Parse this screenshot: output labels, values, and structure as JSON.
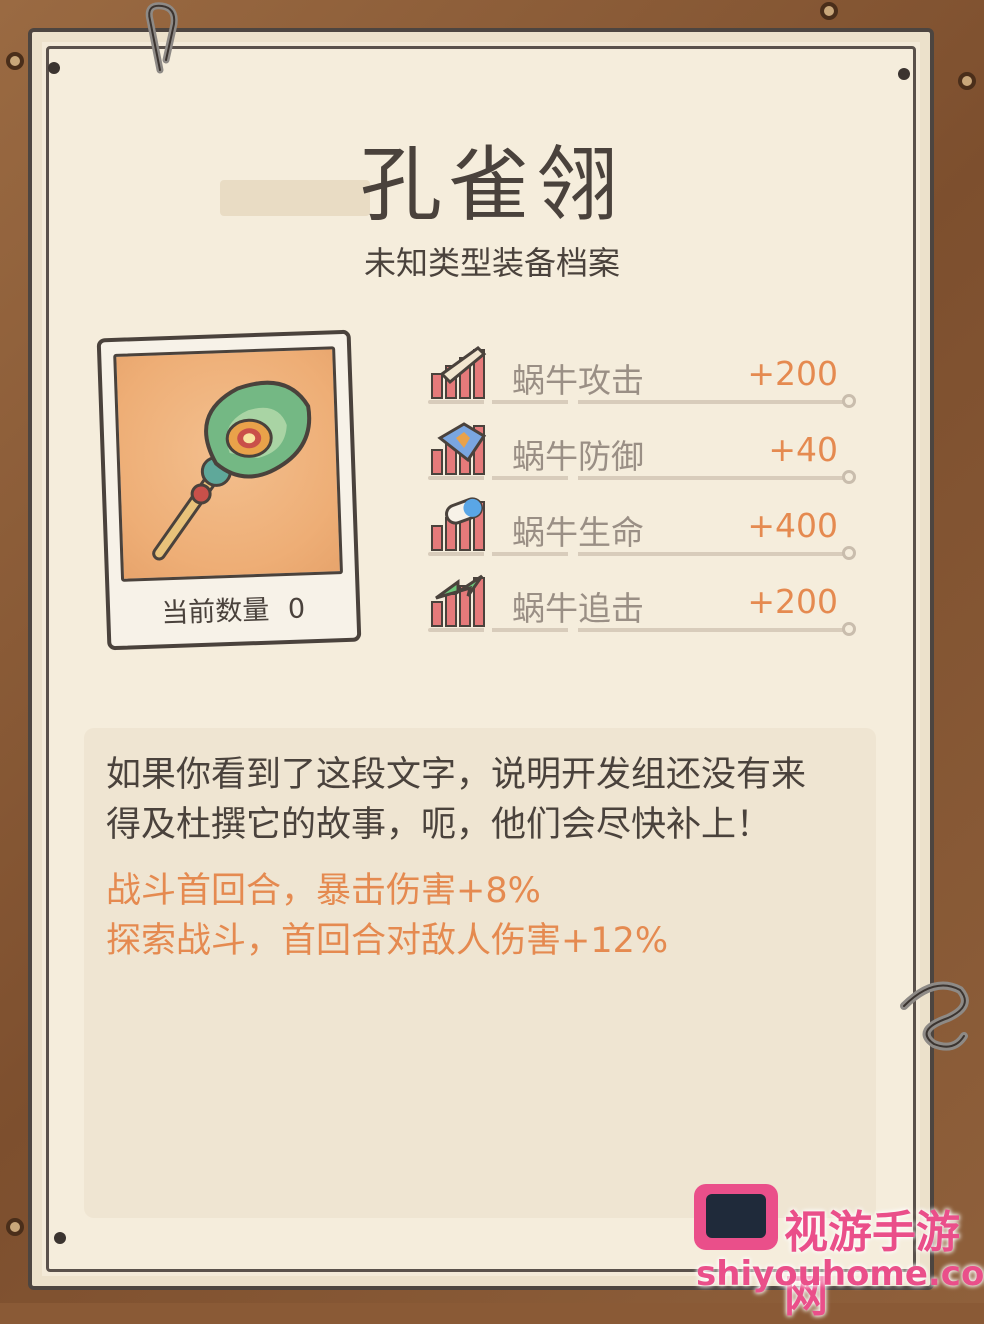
{
  "item": {
    "name": "孔雀翎",
    "category": "未知类型装备档案",
    "count_label": "当前数量",
    "count_value": "0",
    "icon": "peacock-feather-icon"
  },
  "stats": [
    {
      "label": "蜗牛攻击",
      "value": "+200",
      "icon": "sword-icon"
    },
    {
      "label": "蜗牛防御",
      "value": "+40",
      "icon": "shield-icon"
    },
    {
      "label": "蜗牛生命",
      "value": "+400",
      "icon": "pill-icon"
    },
    {
      "label": "蜗牛追击",
      "value": "+200",
      "icon": "lightning-icon"
    }
  ],
  "description": {
    "line1": "如果你看到了这段文字，说明开发组还没有来",
    "line2": "得及杜撰它的故事，呃，他们会尽快补上！",
    "effects": [
      "战斗首回合，暴击伤害+8%",
      "探索战斗，首回合对敌人伤害+12%"
    ]
  },
  "watermark": {
    "name": "视游手游网",
    "url": "shiyouhome.com"
  },
  "colors": {
    "accent": "#e58a50",
    "text": "#4a423c",
    "muted": "#9a8f85",
    "paper": "#f3ead8",
    "frame": "#8a5a36"
  }
}
